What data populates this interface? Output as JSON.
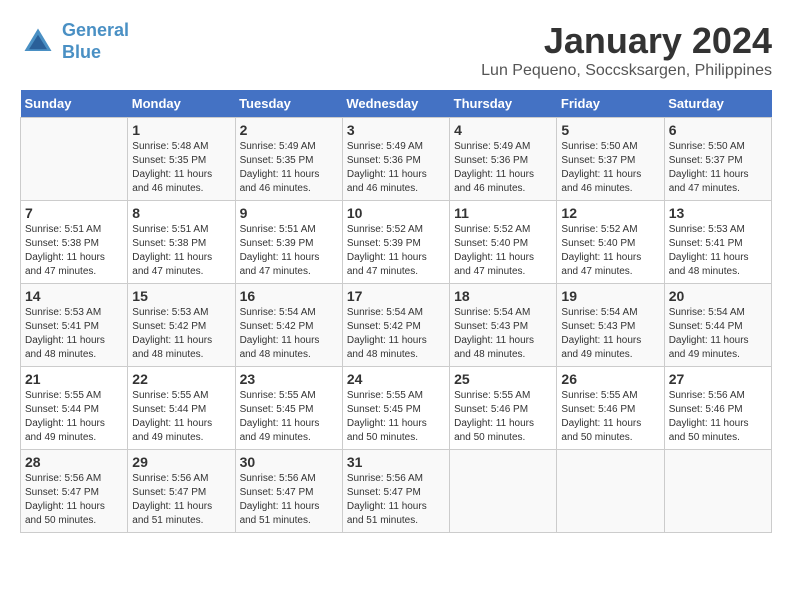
{
  "header": {
    "logo_line1": "General",
    "logo_line2": "Blue",
    "main_title": "January 2024",
    "subtitle": "Lun Pequeno, Soccsksargen, Philippines"
  },
  "days_of_week": [
    "Sunday",
    "Monday",
    "Tuesday",
    "Wednesday",
    "Thursday",
    "Friday",
    "Saturday"
  ],
  "weeks": [
    [
      {
        "day": "",
        "info": ""
      },
      {
        "day": "1",
        "info": "Sunrise: 5:48 AM\nSunset: 5:35 PM\nDaylight: 11 hours and 46 minutes."
      },
      {
        "day": "2",
        "info": "Sunrise: 5:49 AM\nSunset: 5:35 PM\nDaylight: 11 hours and 46 minutes."
      },
      {
        "day": "3",
        "info": "Sunrise: 5:49 AM\nSunset: 5:36 PM\nDaylight: 11 hours and 46 minutes."
      },
      {
        "day": "4",
        "info": "Sunrise: 5:49 AM\nSunset: 5:36 PM\nDaylight: 11 hours and 46 minutes."
      },
      {
        "day": "5",
        "info": "Sunrise: 5:50 AM\nSunset: 5:37 PM\nDaylight: 11 hours and 46 minutes."
      },
      {
        "day": "6",
        "info": "Sunrise: 5:50 AM\nSunset: 5:37 PM\nDaylight: 11 hours and 47 minutes."
      }
    ],
    [
      {
        "day": "7",
        "info": "Sunrise: 5:51 AM\nSunset: 5:38 PM\nDaylight: 11 hours and 47 minutes."
      },
      {
        "day": "8",
        "info": "Sunrise: 5:51 AM\nSunset: 5:38 PM\nDaylight: 11 hours and 47 minutes."
      },
      {
        "day": "9",
        "info": "Sunrise: 5:51 AM\nSunset: 5:39 PM\nDaylight: 11 hours and 47 minutes."
      },
      {
        "day": "10",
        "info": "Sunrise: 5:52 AM\nSunset: 5:39 PM\nDaylight: 11 hours and 47 minutes."
      },
      {
        "day": "11",
        "info": "Sunrise: 5:52 AM\nSunset: 5:40 PM\nDaylight: 11 hours and 47 minutes."
      },
      {
        "day": "12",
        "info": "Sunrise: 5:52 AM\nSunset: 5:40 PM\nDaylight: 11 hours and 47 minutes."
      },
      {
        "day": "13",
        "info": "Sunrise: 5:53 AM\nSunset: 5:41 PM\nDaylight: 11 hours and 48 minutes."
      }
    ],
    [
      {
        "day": "14",
        "info": "Sunrise: 5:53 AM\nSunset: 5:41 PM\nDaylight: 11 hours and 48 minutes."
      },
      {
        "day": "15",
        "info": "Sunrise: 5:53 AM\nSunset: 5:42 PM\nDaylight: 11 hours and 48 minutes."
      },
      {
        "day": "16",
        "info": "Sunrise: 5:54 AM\nSunset: 5:42 PM\nDaylight: 11 hours and 48 minutes."
      },
      {
        "day": "17",
        "info": "Sunrise: 5:54 AM\nSunset: 5:42 PM\nDaylight: 11 hours and 48 minutes."
      },
      {
        "day": "18",
        "info": "Sunrise: 5:54 AM\nSunset: 5:43 PM\nDaylight: 11 hours and 48 minutes."
      },
      {
        "day": "19",
        "info": "Sunrise: 5:54 AM\nSunset: 5:43 PM\nDaylight: 11 hours and 49 minutes."
      },
      {
        "day": "20",
        "info": "Sunrise: 5:54 AM\nSunset: 5:44 PM\nDaylight: 11 hours and 49 minutes."
      }
    ],
    [
      {
        "day": "21",
        "info": "Sunrise: 5:55 AM\nSunset: 5:44 PM\nDaylight: 11 hours and 49 minutes."
      },
      {
        "day": "22",
        "info": "Sunrise: 5:55 AM\nSunset: 5:44 PM\nDaylight: 11 hours and 49 minutes."
      },
      {
        "day": "23",
        "info": "Sunrise: 5:55 AM\nSunset: 5:45 PM\nDaylight: 11 hours and 49 minutes."
      },
      {
        "day": "24",
        "info": "Sunrise: 5:55 AM\nSunset: 5:45 PM\nDaylight: 11 hours and 50 minutes."
      },
      {
        "day": "25",
        "info": "Sunrise: 5:55 AM\nSunset: 5:46 PM\nDaylight: 11 hours and 50 minutes."
      },
      {
        "day": "26",
        "info": "Sunrise: 5:55 AM\nSunset: 5:46 PM\nDaylight: 11 hours and 50 minutes."
      },
      {
        "day": "27",
        "info": "Sunrise: 5:56 AM\nSunset: 5:46 PM\nDaylight: 11 hours and 50 minutes."
      }
    ],
    [
      {
        "day": "28",
        "info": "Sunrise: 5:56 AM\nSunset: 5:47 PM\nDaylight: 11 hours and 50 minutes."
      },
      {
        "day": "29",
        "info": "Sunrise: 5:56 AM\nSunset: 5:47 PM\nDaylight: 11 hours and 51 minutes."
      },
      {
        "day": "30",
        "info": "Sunrise: 5:56 AM\nSunset: 5:47 PM\nDaylight: 11 hours and 51 minutes."
      },
      {
        "day": "31",
        "info": "Sunrise: 5:56 AM\nSunset: 5:47 PM\nDaylight: 11 hours and 51 minutes."
      },
      {
        "day": "",
        "info": ""
      },
      {
        "day": "",
        "info": ""
      },
      {
        "day": "",
        "info": ""
      }
    ]
  ]
}
